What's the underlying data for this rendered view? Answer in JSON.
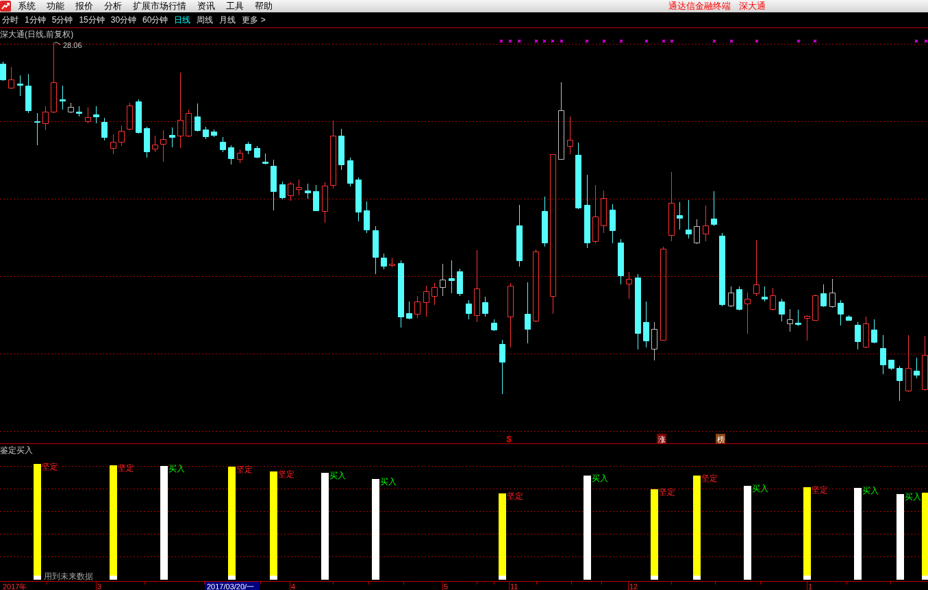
{
  "menu_bar": {
    "items": [
      "系统",
      "功能",
      "报价",
      "分析",
      "扩展市场行情",
      "资讯",
      "工具",
      "帮助"
    ],
    "app_title": "通达信金融终端",
    "stock_name": "深大通"
  },
  "period_tabs": [
    {
      "label": "分时",
      "selected": false
    },
    {
      "label": "1分钟",
      "selected": false
    },
    {
      "label": "5分钟",
      "selected": false
    },
    {
      "label": "15分钟",
      "selected": false
    },
    {
      "label": "30分钟",
      "selected": false
    },
    {
      "label": "60分钟",
      "selected": false
    },
    {
      "label": "日线",
      "selected": true
    },
    {
      "label": "周线",
      "selected": false
    },
    {
      "label": "月线",
      "selected": false
    },
    {
      "label": "更多 >",
      "selected": false
    }
  ],
  "main_chart": {
    "title": "深大通(日线,前复权)",
    "high_label": "28.06",
    "event_markers": [
      {
        "text": "$",
        "kind": "symbol",
        "color": "#ff0000"
      },
      {
        "text": "涨",
        "kind": "badge",
        "color": "#800000"
      },
      {
        "text": "榜",
        "kind": "badge",
        "color": "#8b4513"
      }
    ]
  },
  "indicator_pane": {
    "title": "鉴定买入",
    "note": "用到未来数据",
    "signals": [
      {
        "kind": "firm",
        "label": "坚定"
      },
      {
        "kind": "firm",
        "label": "坚定"
      },
      {
        "kind": "buy",
        "label": "买入"
      },
      {
        "kind": "firm",
        "label": "坚定"
      },
      {
        "kind": "firm",
        "label": "坚定"
      },
      {
        "kind": "buy",
        "label": "买入"
      },
      {
        "kind": "buy",
        "label": "买入"
      },
      {
        "kind": "firm",
        "label": "坚定"
      },
      {
        "kind": "buy",
        "label": "买入"
      },
      {
        "kind": "firm",
        "label": "坚定"
      },
      {
        "kind": "firm",
        "label": "坚定"
      },
      {
        "kind": "buy",
        "label": "买入"
      },
      {
        "kind": "firm",
        "label": "坚定"
      },
      {
        "kind": "buy",
        "label": "买入"
      },
      {
        "kind": "buy",
        "label": "买入"
      },
      {
        "kind": "firm"
      }
    ]
  },
  "time_axis": {
    "labels": [
      "2017年",
      "3",
      "4",
      "5",
      "11",
      "12",
      "1"
    ],
    "cursor_date": "2017/03/20/一"
  }
}
